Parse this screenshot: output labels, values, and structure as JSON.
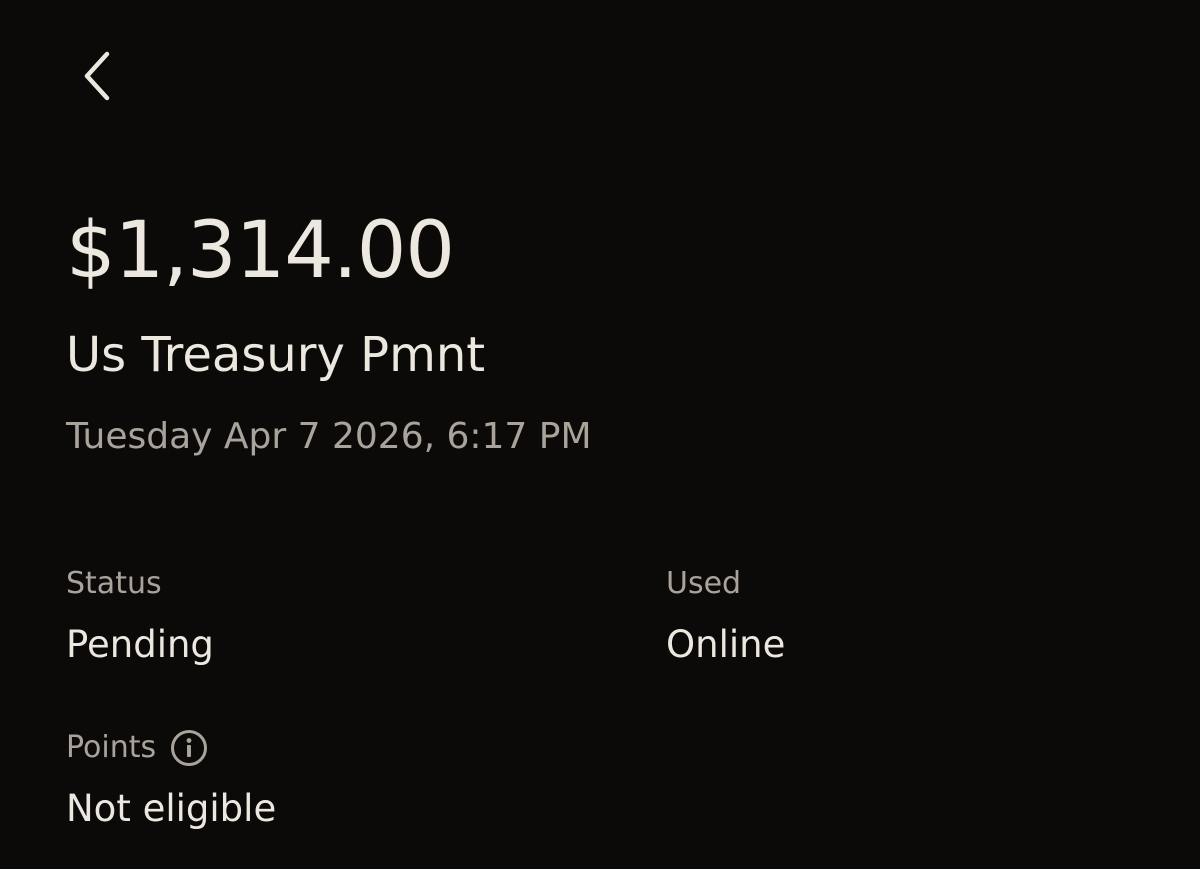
{
  "transaction": {
    "amount": "$1,314.00",
    "merchant": "Us Treasury Pmnt",
    "datetime": "Tuesday Apr 7 2026, 6:17 PM"
  },
  "details": {
    "status": {
      "label": "Status",
      "value": "Pending"
    },
    "used": {
      "label": "Used",
      "value": "Online"
    },
    "points": {
      "label": "Points",
      "value": "Not eligible",
      "info_icon": "info-icon"
    }
  },
  "navigation": {
    "back_icon": "chevron-left-icon"
  },
  "colors": {
    "background": "#0c0a08",
    "primary_text": "#ece7df",
    "secondary_text": "#a9a39b"
  }
}
